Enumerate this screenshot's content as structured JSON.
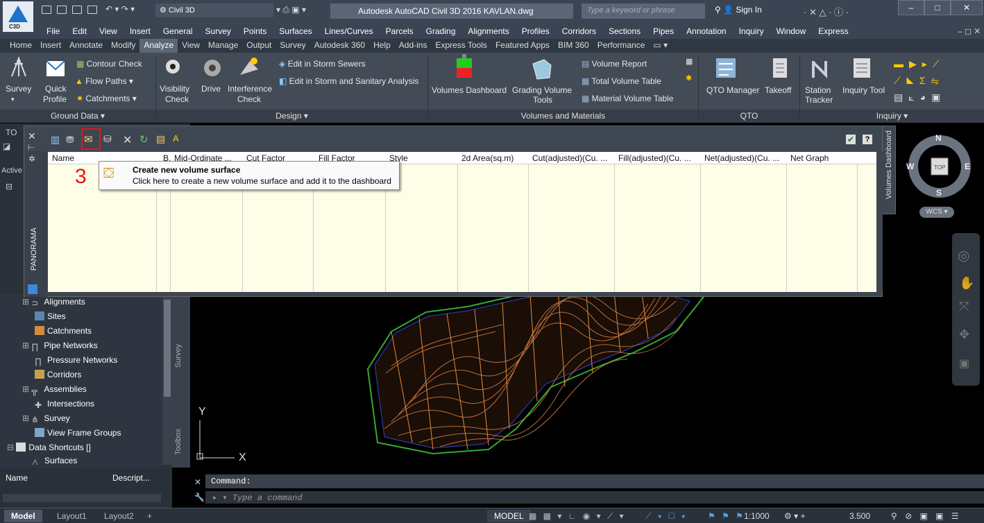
{
  "titlebar": {
    "workspace": "Civil 3D",
    "app_title": "Autodesk AutoCAD Civil 3D 2016   KAVLAN.dwg",
    "search_placeholder": "Type a keyword or phrase",
    "sign_in": "Sign In",
    "logo_text": "C3D"
  },
  "menu": [
    "File",
    "Edit",
    "View",
    "Insert",
    "General",
    "Survey",
    "Points",
    "Surfaces",
    "Lines/Curves",
    "Parcels",
    "Grading",
    "Alignments",
    "Profiles",
    "Corridors",
    "Sections",
    "Pipes",
    "Annotation",
    "Inquiry",
    "Window",
    "Express"
  ],
  "ribbon_tabs": [
    "Home",
    "Insert",
    "Annotate",
    "Modify",
    "Analyze",
    "View",
    "Manage",
    "Output",
    "Survey",
    "Autodesk 360",
    "Help",
    "Add-ins",
    "Express Tools",
    "Featured Apps",
    "BIM 360",
    "Performance"
  ],
  "ribbon": {
    "survey": "Survey",
    "quick_profile": [
      "Quick",
      "Profile"
    ],
    "contour_check": "Contour Check",
    "flow_paths": "Flow Paths",
    "catchments": "Catchments",
    "visibility_check": [
      "Visibility",
      "Check"
    ],
    "drive": "Drive",
    "interference_check": [
      "Interference",
      "Check"
    ],
    "edit_storm": "Edit in Storm Sewers",
    "edit_storm_sanitary": "Edit in Storm and Sanitary Analysis",
    "volumes_dashboard": "Volumes Dashboard",
    "grading_volume_tools": [
      "Grading Volume",
      "Tools"
    ],
    "volume_report": "Volume Report",
    "total_volume_table": "Total Volume Table",
    "material_volume_table": "Material Volume Table",
    "qto_manager": "QTO Manager",
    "takeoff": "Takeoff",
    "station_tracker": [
      "Station",
      "Tracker"
    ],
    "inquiry_tool": "Inquiry Tool",
    "panels": [
      "Ground Data",
      "Design",
      "Volumes and Materials",
      "QTO",
      "Inquiry"
    ]
  },
  "dashboard": {
    "columns": [
      "Name",
      "B...",
      "Mid-Ordinate ...",
      "Cut Factor",
      "Fill Factor",
      "Style",
      "2d Area(sq.m)",
      "Cut(adjusted)(Cu. ...",
      "Fill(adjusted)(Cu. ...",
      "Net(adjusted)(Cu. ...",
      "Net Graph"
    ],
    "side_tab": "Volumes Dashboard",
    "panorama": "PANORAMA"
  },
  "tooltip": {
    "title": "Create new volume surface",
    "desc": "Click here to create a new volume surface and add it to the dashboard"
  },
  "step_number": "3",
  "toolspace": {
    "label_to": "TO",
    "active": "Active",
    "items": [
      "Alignments",
      "Sites",
      "Catchments",
      "Pipe Networks",
      "Pressure Networks",
      "Corridors",
      "Assemblies",
      "Intersections",
      "Survey",
      "View Frame Groups",
      "Data Shortcuts []",
      "Surfaces"
    ],
    "vtabs": [
      "Survey",
      "Toolbox"
    ],
    "props_cols": [
      "Name",
      "Descript..."
    ]
  },
  "viewcube": {
    "n": "N",
    "s": "S",
    "e": "E",
    "w": "W",
    "top": "TOP",
    "wcs": "WCS"
  },
  "ucs": {
    "x": "X",
    "y": "Y"
  },
  "command": {
    "label": "Command:",
    "placeholder": "Type a command"
  },
  "status": {
    "tabs": [
      "Model",
      "Layout1",
      "Layout2"
    ],
    "model": "MODEL",
    "scale": "1:1000",
    "value": "3.500"
  }
}
